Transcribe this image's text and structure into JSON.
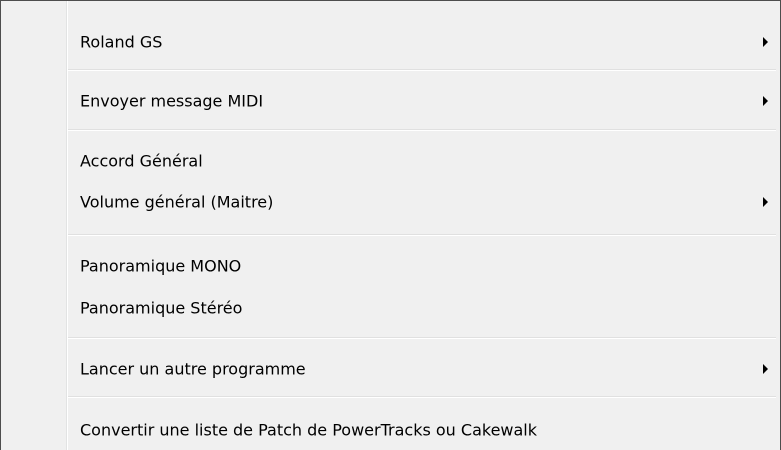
{
  "menu": {
    "items": [
      {
        "label": "Roland GS",
        "submenu": true
      },
      {
        "label": "Envoyer message MIDI",
        "submenu": true
      },
      {
        "label": "Accord Général",
        "submenu": false
      },
      {
        "label": "Volume général (Maitre)",
        "submenu": true
      },
      {
        "label": "Panoramique MONO",
        "submenu": false
      },
      {
        "label": "Panoramique Stéréo",
        "submenu": false
      },
      {
        "label": "Lancer un autre programme",
        "submenu": true
      },
      {
        "label": "Convertir une liste de Patch de PowerTracks ou Cakewalk",
        "submenu": false
      }
    ],
    "colors": {
      "background": "#f0f0f0",
      "border": "#4d4d4d",
      "separator": "#e0e0e0",
      "text": "#000000"
    },
    "icons": {
      "submenu_arrow": "submenu-arrow-icon"
    }
  }
}
